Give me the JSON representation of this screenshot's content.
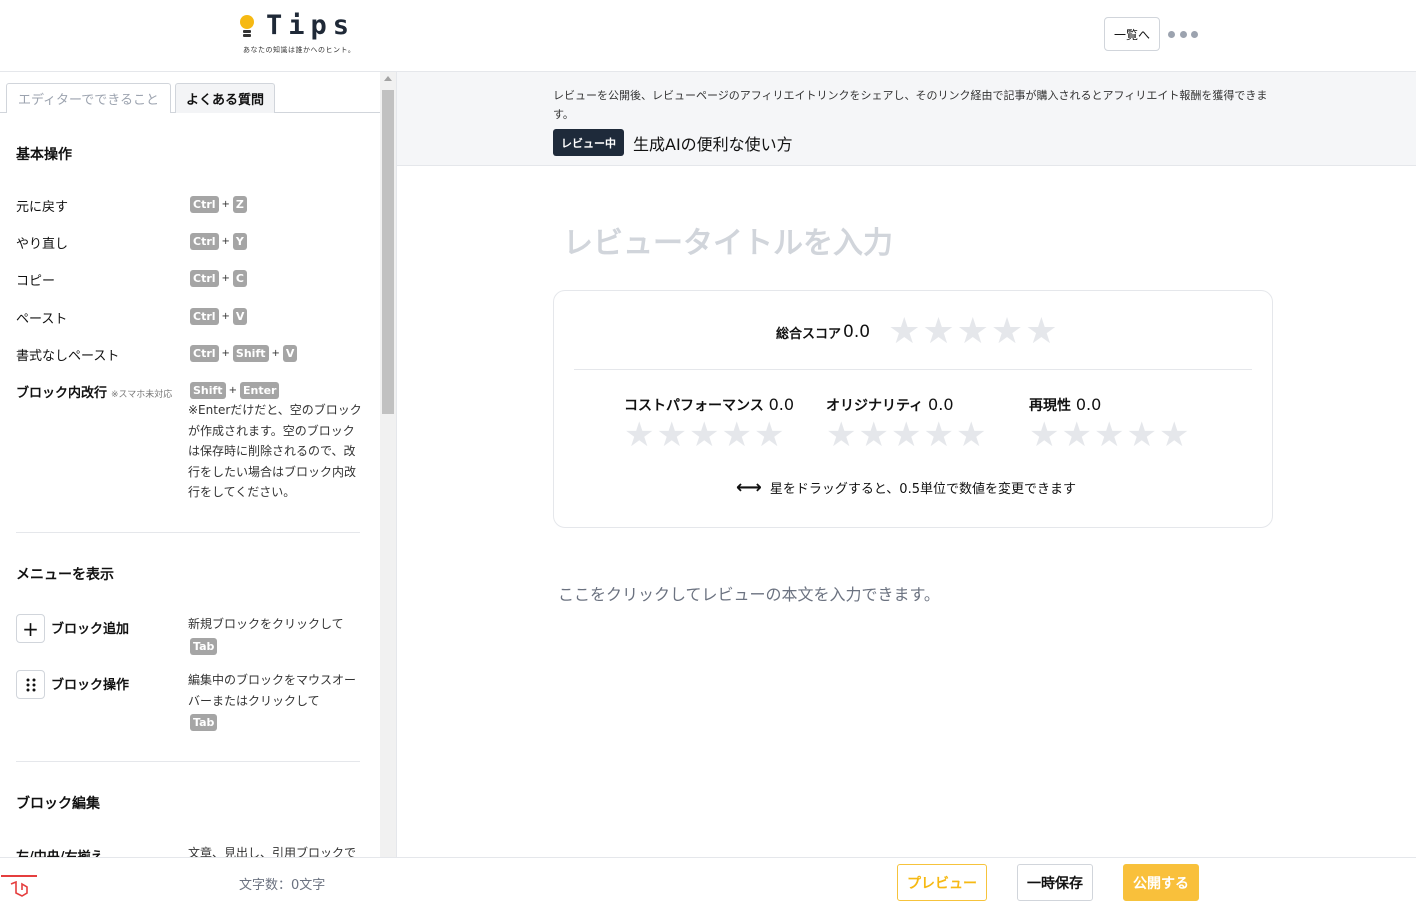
{
  "header": {
    "logo_text": "Tips",
    "logo_tagline": "あなたの知識は誰かへのヒント。",
    "list_button": "一覧へ"
  },
  "left": {
    "tabs": [
      "エディターでできること",
      "よくある質問"
    ],
    "sections": {
      "basic": {
        "title": "基本操作",
        "rows": [
          {
            "label": "元に戻す",
            "keys": [
              "Ctrl",
              "Z"
            ]
          },
          {
            "label": "やり直し",
            "keys": [
              "Ctrl",
              "Y"
            ]
          },
          {
            "label": "コピー",
            "keys": [
              "Ctrl",
              "C"
            ]
          },
          {
            "label": "ペースト",
            "keys": [
              "Ctrl",
              "V"
            ]
          },
          {
            "label": "書式なしペースト",
            "keys": [
              "Ctrl",
              "Shift",
              "V"
            ]
          },
          {
            "label": "ブロック内改行",
            "note_small": "※スマホ未対応",
            "keys": [
              "Shift",
              "Enter"
            ],
            "note": "※Enterだけだと、空のブロックが作成されます。空のブロックは保存時に削除されるので、改行をしたい場合はブロック内改行をしてください。"
          }
        ]
      },
      "menu": {
        "title": "メニューを表示",
        "rows": [
          {
            "label": "ブロック追加",
            "note": "新規ブロックをクリックして",
            "key": "Tab"
          },
          {
            "label": "ブロック操作",
            "note": "編集中のブロックをマウスオーバーまたはクリックして",
            "key": "Tab"
          }
        ]
      },
      "edit": {
        "title": "ブロック編集",
        "rows": [
          {
            "label": "左/中央/右揃え",
            "note": "文章、見出し、引用ブロックで"
          }
        ]
      }
    },
    "plus_sign": "+"
  },
  "main": {
    "notice": "レビューを公開後、レビューページのアフィリエイトリンクをシェアし、そのリンク経由で記事が購入されるとアフィリエイト報酬を獲得できます。",
    "badge": "レビュー中",
    "article_title": "生成AIの便利な使い方",
    "title_placeholder": "レビュータイトルを入力",
    "score": {
      "total_label": "総合スコア",
      "total_value": "0.0",
      "subs": [
        {
          "label": "コストパフォーマンス",
          "value": "0.0"
        },
        {
          "label": "オリジナリティ",
          "value": "0.0"
        },
        {
          "label": "再現性",
          "value": "0.0"
        }
      ],
      "drag_hint": "星をドラッグすると、0.5単位で数値を変更できます"
    },
    "body_placeholder": "ここをクリックしてレビューの本文を入力できます。"
  },
  "footer": {
    "word_count": "文字数：0文字",
    "preview": "プレビュー",
    "save": "一時保存",
    "publish": "公開する"
  },
  "colors": {
    "accent": "#f9c03b",
    "badge_bg": "#1e2a3a",
    "star_empty": "#e5e7eb"
  }
}
